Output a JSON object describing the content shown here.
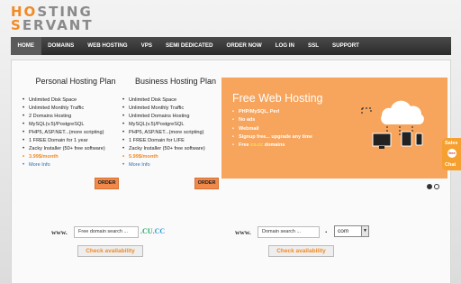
{
  "logo": {
    "line1_a": "HO",
    "line1_b": "STING",
    "line2_a": "S",
    "line2_b": "ERVANT"
  },
  "nav": [
    "HOME",
    "DOMAINS",
    "WEB HOSTING",
    "VPS",
    "SEMI DEDICATED",
    "ORDER NOW",
    "LOG IN",
    "SSL",
    "SUPPORT"
  ],
  "plans": [
    {
      "title": "Personal Hosting Plan",
      "features": [
        "Unlimited Disk Space",
        "Unlimited Monthly Traffic",
        "2 Domains Hosting",
        "MySQL(v.5)/PostgreSQL",
        "PHP5, ASP.NET...(more scripting)",
        "1 FREE Domain for 1 year",
        "Zacky Installer (50+ free software)"
      ],
      "price": "3.99$/month",
      "more": "More Info",
      "order": "ORDER"
    },
    {
      "title": "Business Hosting Plan",
      "features": [
        "Unlimited Disk Space",
        "Unlimited Monthly Traffic",
        "Unlimited Domains Hosting",
        "MySQL(v.5)/PostgreSQL",
        "PHP5, ASP.NET...(more scripting)",
        "1 FREE Domain for LIFE",
        "Zacky Installer (50+ free software)"
      ],
      "price": "5.99$/month",
      "more": "More Info",
      "order": "ORDER"
    }
  ],
  "banner": {
    "title": "Free Web Hosting",
    "items": [
      "PHP/MySQL, Perl",
      "No ads",
      "Webmail",
      "Signup free... upgrade any time"
    ],
    "last_pre": "Free ",
    "last_hl": "co.cc",
    "last_post": " domains",
    "colors": {
      "bg": "#f7a45c",
      "highlight": "#f4e44c"
    }
  },
  "chat": {
    "sales": "Sales",
    "free": "free",
    "chat": "Chat"
  },
  "domain_left": {
    "www": "www.",
    "placeholder": "Free domain search ...",
    "tld_a": ".CU",
    "tld_b": ".CC",
    "button": "Check availability"
  },
  "domain_right": {
    "www": "www.",
    "placeholder": "Domain search ...",
    "dot": ".",
    "tld": "com",
    "button": "Check availability"
  },
  "accent": "#f08a24"
}
